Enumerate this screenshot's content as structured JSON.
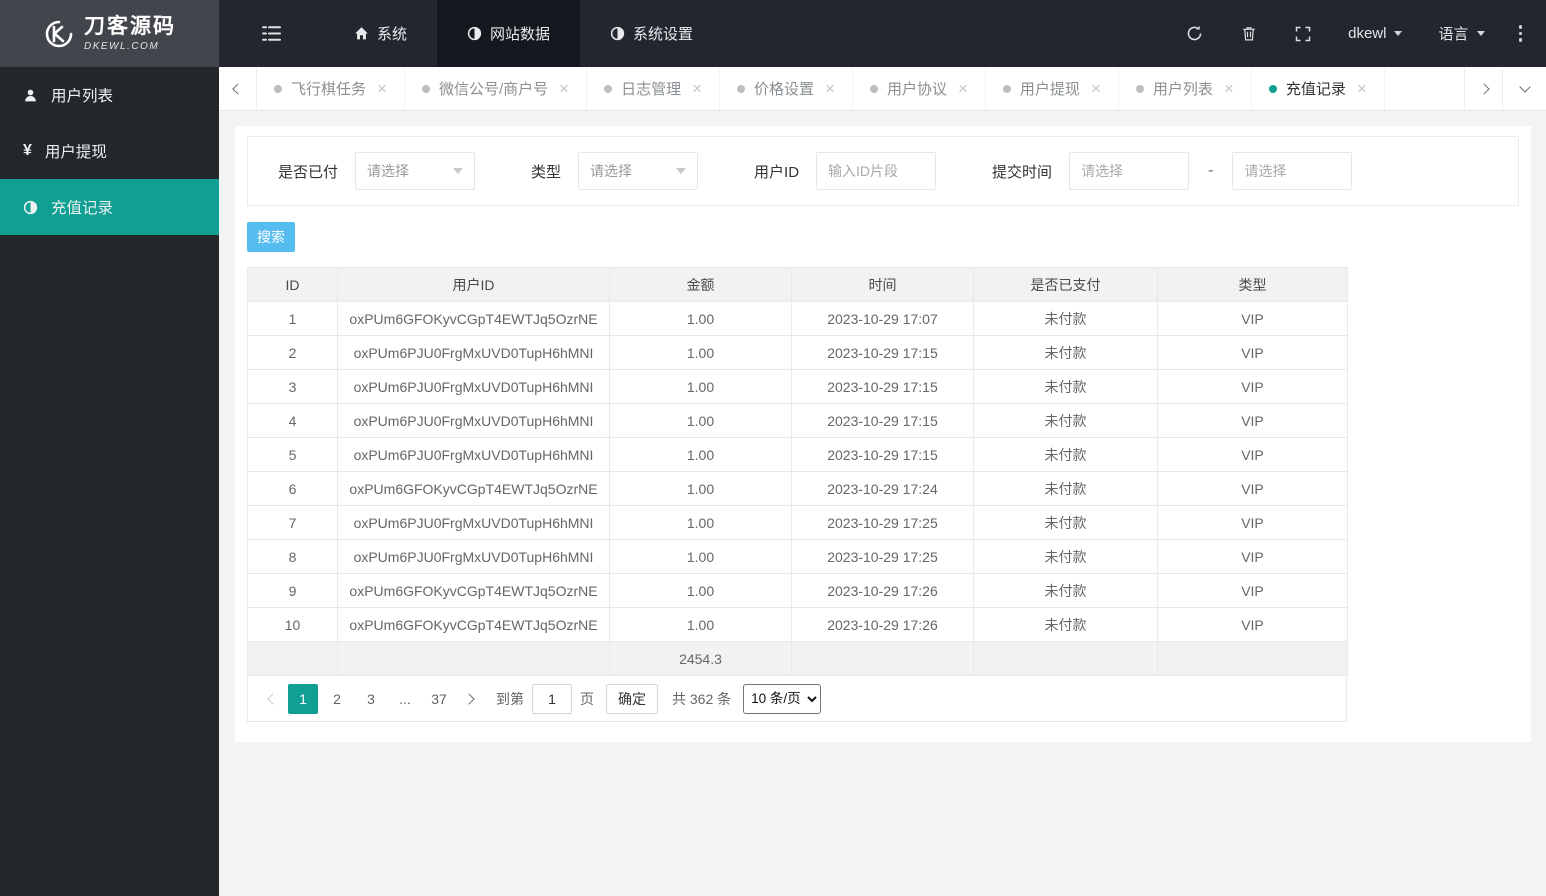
{
  "colors": {
    "accent_teal": "#0fa093",
    "topbar_bg": "#23262e",
    "sidebar_bg": "#23262b",
    "search_button_blue": "#55bdf0"
  },
  "topbar": {
    "logo": {
      "title": "刀客源码",
      "subtitle": "DKEWL.COM"
    },
    "nav_items": [
      {
        "label": "系统",
        "icon": "home-icon",
        "active": false
      },
      {
        "label": "网站数据",
        "icon": "pie-icon",
        "active": true
      },
      {
        "label": "系统设置",
        "icon": "pie-icon",
        "active": false
      }
    ],
    "username": "dkewl",
    "language": "语言"
  },
  "tabbar": {
    "close_glyph": "×",
    "tabs": [
      {
        "label": "飞行棋任务",
        "active": false
      },
      {
        "label": "微信公号/商户号",
        "active": false
      },
      {
        "label": "日志管理",
        "active": false
      },
      {
        "label": "价格设置",
        "active": false
      },
      {
        "label": "用户协议",
        "active": false
      },
      {
        "label": "用户提现",
        "active": false
      },
      {
        "label": "用户列表",
        "active": false
      },
      {
        "label": "充值记录",
        "active": true
      }
    ]
  },
  "sidebar": {
    "items": [
      {
        "label": "用户列表",
        "icon": "user-icon",
        "active": false
      },
      {
        "label": "用户提现",
        "icon": "yen-icon",
        "active": false
      },
      {
        "label": "充值记录",
        "icon": "pie-icon",
        "active": true
      }
    ]
  },
  "filters": {
    "paid": {
      "label": "是否已付",
      "value": "请选择"
    },
    "type": {
      "label": "类型",
      "value": "请选择"
    },
    "user_id": {
      "label": "用户ID",
      "placeholder": "输入ID片段"
    },
    "time": {
      "label": "提交时间",
      "start_placeholder": "请选择",
      "end_placeholder": "请选择",
      "separator": "-"
    },
    "search_button": "搜索"
  },
  "table": {
    "headers": [
      "ID",
      "用户ID",
      "金额",
      "时间",
      "是否已支付",
      "类型"
    ],
    "rows": [
      [
        "1",
        "oxPUm6GFOKyvCGpT4EWTJq5OzrNE",
        "1.00",
        "2023-10-29 17:07",
        "未付款",
        "VIP"
      ],
      [
        "2",
        "oxPUm6PJU0FrgMxUVD0TupH6hMNI",
        "1.00",
        "2023-10-29 17:15",
        "未付款",
        "VIP"
      ],
      [
        "3",
        "oxPUm6PJU0FrgMxUVD0TupH6hMNI",
        "1.00",
        "2023-10-29 17:15",
        "未付款",
        "VIP"
      ],
      [
        "4",
        "oxPUm6PJU0FrgMxUVD0TupH6hMNI",
        "1.00",
        "2023-10-29 17:15",
        "未付款",
        "VIP"
      ],
      [
        "5",
        "oxPUm6PJU0FrgMxUVD0TupH6hMNI",
        "1.00",
        "2023-10-29 17:15",
        "未付款",
        "VIP"
      ],
      [
        "6",
        "oxPUm6GFOKyvCGpT4EWTJq5OzrNE",
        "1.00",
        "2023-10-29 17:24",
        "未付款",
        "VIP"
      ],
      [
        "7",
        "oxPUm6PJU0FrgMxUVD0TupH6hMNI",
        "1.00",
        "2023-10-29 17:25",
        "未付款",
        "VIP"
      ],
      [
        "8",
        "oxPUm6PJU0FrgMxUVD0TupH6hMNI",
        "1.00",
        "2023-10-29 17:25",
        "未付款",
        "VIP"
      ],
      [
        "9",
        "oxPUm6GFOKyvCGpT4EWTJq5OzrNE",
        "1.00",
        "2023-10-29 17:26",
        "未付款",
        "VIP"
      ],
      [
        "10",
        "oxPUm6GFOKyvCGpT4EWTJq5OzrNE",
        "1.00",
        "2023-10-29 17:26",
        "未付款",
        "VIP"
      ]
    ],
    "total_amount": "2454.3"
  },
  "pagination": {
    "pages": [
      "1",
      "2",
      "3",
      "...",
      "37"
    ],
    "active_page": "1",
    "goto_label": "到第",
    "goto_value": "1",
    "goto_unit": "页",
    "confirm_label": "确定",
    "total_label": "共 362 条",
    "page_size_label": "10 条/页"
  }
}
